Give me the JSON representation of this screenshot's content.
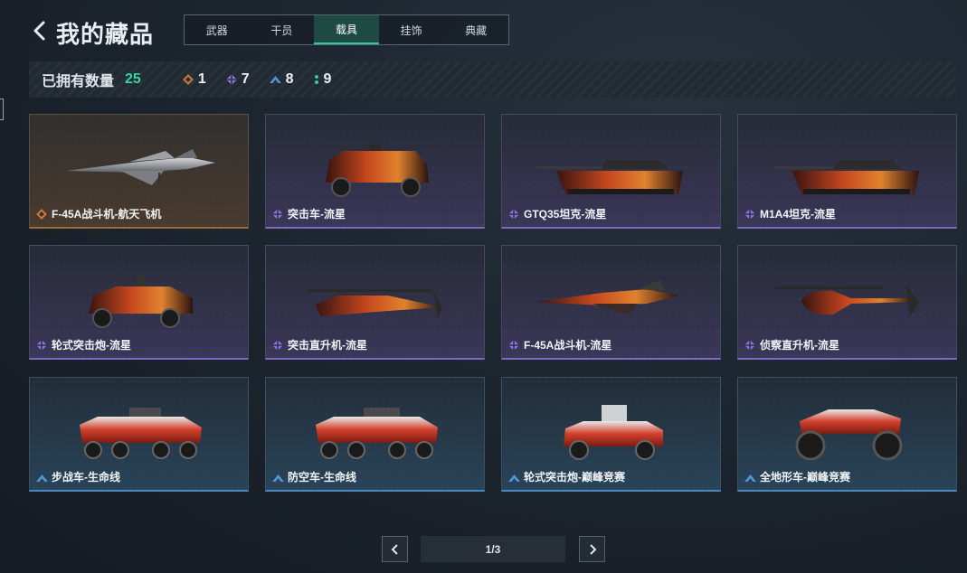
{
  "header": {
    "title": "我的藏品",
    "tabs": [
      {
        "label": "武器",
        "active": false
      },
      {
        "label": "干员",
        "active": false
      },
      {
        "label": "载具",
        "active": true
      },
      {
        "label": "挂饰",
        "active": false
      },
      {
        "label": "典藏",
        "active": false
      }
    ]
  },
  "stats": {
    "label": "已拥有数量",
    "total": "25",
    "counts": [
      {
        "rarity": "gold",
        "icon": "orange-diamond-icon",
        "value": "1",
        "color": "#c9743a"
      },
      {
        "rarity": "purple",
        "icon": "purple-diamond-icon",
        "value": "7",
        "color": "#8f72e0"
      },
      {
        "rarity": "blue",
        "icon": "blue-chevron-icon",
        "value": "8",
        "color": "#4f96da"
      },
      {
        "rarity": "green",
        "icon": "green-dots-icon",
        "value": "9",
        "color": "#35c9a6"
      }
    ]
  },
  "items": [
    {
      "name": "F-45A战斗机-航天飞机",
      "rarity": "gold",
      "vehicle": "jet-icon"
    },
    {
      "name": "突击车-流星",
      "rarity": "purple",
      "vehicle": "armored-car-icon"
    },
    {
      "name": "GTQ35坦克-流星",
      "rarity": "purple",
      "vehicle": "tank-icon"
    },
    {
      "name": "M1A4坦克-流星",
      "rarity": "purple",
      "vehicle": "tank-icon"
    },
    {
      "name": "轮式突击炮-流星",
      "rarity": "purple",
      "vehicle": "wheeled-gun-icon"
    },
    {
      "name": "突击直升机-流星",
      "rarity": "purple",
      "vehicle": "attack-helicopter-icon"
    },
    {
      "name": "F-45A战斗机-流星",
      "rarity": "purple",
      "vehicle": "jet-icon"
    },
    {
      "name": "侦察直升机-流星",
      "rarity": "purple",
      "vehicle": "scout-helicopter-icon"
    },
    {
      "name": "步战车-生命线",
      "rarity": "blue",
      "vehicle": "ifv-icon"
    },
    {
      "name": "防空车-生命线",
      "rarity": "blue",
      "vehicle": "ifv-icon"
    },
    {
      "name": "轮式突击炮-巅峰竞赛",
      "rarity": "blue",
      "vehicle": "wheeled-gun-icon"
    },
    {
      "name": "全地形车-巅峰竞赛",
      "rarity": "blue",
      "vehicle": "atv-icon"
    }
  ],
  "pager": {
    "text": "1/3"
  }
}
